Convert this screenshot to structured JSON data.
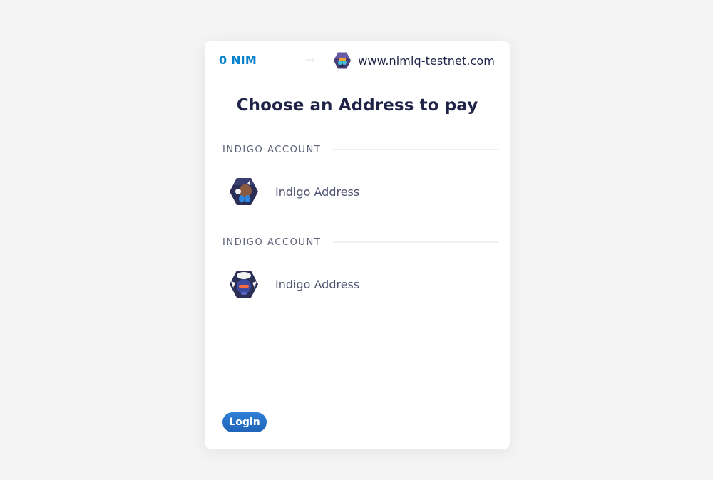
{
  "header": {
    "amount": "0 NIM",
    "arrow_icon": "arrow-right-icon",
    "origin": "www.nimiq-testnet.com",
    "origin_logo_icon": "site-identicon"
  },
  "title": "Choose an Address to pay",
  "accounts": [
    {
      "label": "INDIGO ACCOUNT",
      "addresses": [
        {
          "label": "Indigo Address",
          "avatar_icon": "identicon-icon"
        }
      ]
    },
    {
      "label": "INDIGO ACCOUNT",
      "addresses": [
        {
          "label": "Indigo Address",
          "avatar_icon": "identicon-icon"
        }
      ]
    }
  ],
  "footer": {
    "login_label": "Login"
  },
  "colors": {
    "background": "#f4f4f4",
    "card": "#ffffff",
    "text_dark": "#1f2348",
    "amount_blue": "#0582ca",
    "button_blue": "#2a76cc",
    "identicon_bg": "#2b2e57"
  }
}
